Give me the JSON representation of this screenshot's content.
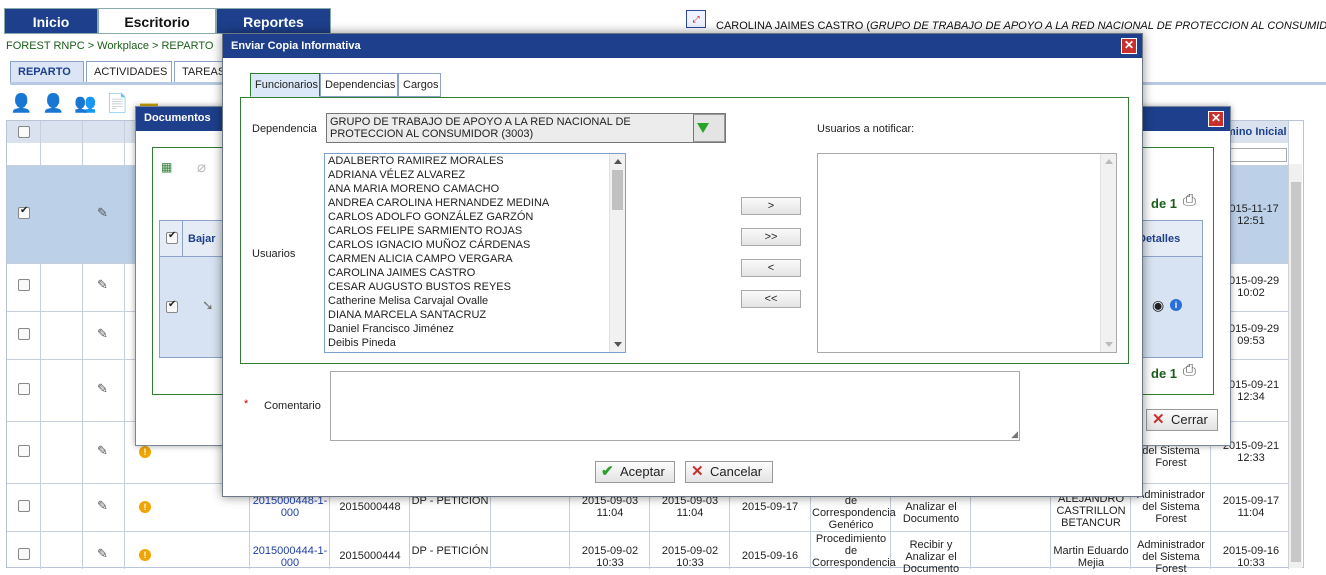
{
  "nav": {
    "tabs": [
      "Inicio",
      "Escritorio",
      "Reportes"
    ]
  },
  "user": {
    "name": "CAROLINA JAIMES CASTRO (",
    "group": "GRUPO DE TRABAJO DE APOYO A LA RED NACIONAL DE PROTECCION AL CONSUMIDOR"
  },
  "breadcrumb": "FOREST RNPC > Workplace > REPARTO",
  "subtabs": [
    "REPARTO",
    "ACTIVIDADES",
    "TAREAS"
  ],
  "grid": {
    "termino_header": "mino Inicial",
    "rows": [
      {
        "date": "2015-11-17",
        "time": "12:51"
      },
      {
        "date": "2015-09-29",
        "time": "10:02"
      },
      {
        "date": "2015-09-29",
        "time": "09:53"
      },
      {
        "date": "2015-09-21",
        "time": "12:34"
      },
      {
        "date": "2015-09-21",
        "time": "12:33",
        "admin": "del Sistema Forest"
      },
      {
        "radicado_link": "2015000448-1-000",
        "radicado": "2015000448",
        "tipo": "DP - PETICIÓN",
        "f1": "2015-09-03 11:04",
        "f2": "2015-09-03 11:04",
        "venc": "2015-09-17",
        "proc": "de Correspondencia Genérico",
        "act": "Analizar el Documento",
        "usr": "ALEJANDRO CASTRILLON BETANCUR",
        "admin": "Administrador del Sistema Forest",
        "date": "2015-09-17",
        "time": "11:04"
      },
      {
        "radicado_link": "2015000444-1-000",
        "radicado": "2015000444",
        "tipo": "DP - PETICIÓN",
        "f1": "2015-09-02 10:33",
        "f2": "2015-09-02 10:33",
        "venc": "2015-09-16",
        "proc": "Procedimiento de Correspondencia",
        "act": "Recibir y Analizar el Documento",
        "usr": "Martin Eduardo Mejia",
        "admin": "Administrador del Sistema Forest",
        "date": "2015-09-16",
        "time": "10:33"
      }
    ]
  },
  "doc_dialog": {
    "title": "Documentos",
    "bajar": "Bajar",
    "detalles": "Detalles",
    "page_of": "de",
    "page_total": "1",
    "close_label": "Cerrar"
  },
  "env_dialog": {
    "title": "Enviar Copia Informativa",
    "tabs": [
      "Funcionarios",
      "Dependencias",
      "Cargos"
    ],
    "dependencia_label": "Dependencia",
    "dependencia_value": "GRUPO DE TRABAJO DE APOYO A LA RED NACIONAL DE PROTECCION AL CONSUMIDOR (3003)",
    "usuarios_label": "Usuarios",
    "notificar_label": "Usuarios a notificar:",
    "usuarios": [
      "ADALBERTO RAMIREZ MORALES",
      "ADRIANA VÉLEZ ALVAREZ",
      "ANA MARIA MORENO CAMACHO",
      "ANDREA CAROLINA HERNANDEZ MEDINA",
      "CARLOS ADOLFO GONZÁLEZ GARZÓN",
      "CARLOS FELIPE SARMIENTO ROJAS",
      "CARLOS IGNACIO MUÑOZ CÁRDENAS",
      "CARMEN ALICIA CAMPO VERGARA",
      "CAROLINA JAIMES CASTRO",
      "CESAR AUGUSTO BUSTOS REYES",
      "Catherine Melisa Carvajal Ovalle",
      "DIANA MARCELA SANTACRUZ",
      "Daniel Francisco Jiménez",
      "Deibis Pineda"
    ],
    "move_buttons": [
      ">",
      ">>",
      "<",
      "<<"
    ],
    "comment_required": "*",
    "comment_label": "Comentario",
    "accept_label": "Aceptar",
    "cancel_label": "Cancelar"
  }
}
